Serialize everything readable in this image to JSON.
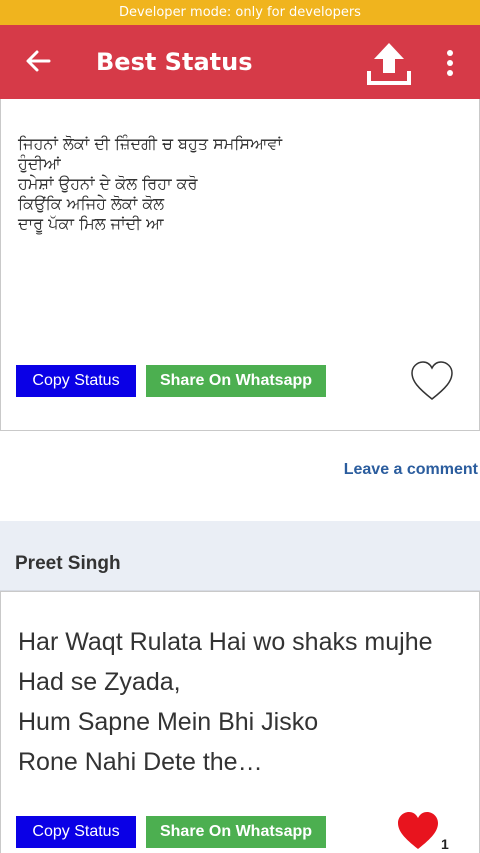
{
  "system": {
    "developer_banner": "Developer mode: only for developers"
  },
  "app_bar": {
    "title": "Best Status",
    "back_icon": "arrow-left-icon",
    "upload_icon": "upload-icon",
    "more_icon": "more-vertical-icon",
    "color": "#d63a48"
  },
  "posts": [
    {
      "text": "ਜਿਹਨਾਂ ਲੋਕਾਂ ਦੀ ਜ਼ਿੰਦਗੀ ਚ ਬਹੁਤ ਸਮਸਿਆਵਾਂ\nਹੁੰਦੀਆਂ\nਹਮੇਸ਼ਾਂ ਉਹਨਾਂ ਦੇ ਕੋਲ ਰਿਹਾ ਕਰੋ\nਕਿਉਂਕਿ ਅਜਿਹੇ ਲੋਕਾਂ ਕੋਲ\nਦਾਰੂ ਪੱਕਾ ਮਿਲ ਜਾਂਦੀ ਆ",
      "copy_label": "Copy Status",
      "share_label": "Share On Whatsapp",
      "liked": false
    },
    {
      "text": "Har Waqt Rulata Hai wo shaks mujhe\nHad se Zyada,\nHum Sapne Mein Bhi Jisko\nRone Nahi Dete the…",
      "copy_label": "Copy Status",
      "share_label": "Share On Whatsapp",
      "liked": true,
      "likes": "1"
    }
  ],
  "comment": {
    "leave_label": "Leave a comment"
  },
  "author": {
    "name": "Preet Singh"
  },
  "colors": {
    "copy_button": "#0a00e6",
    "share_button": "#4caf50",
    "heart_liked": "#e8141e",
    "link": "#2b5d9e"
  }
}
